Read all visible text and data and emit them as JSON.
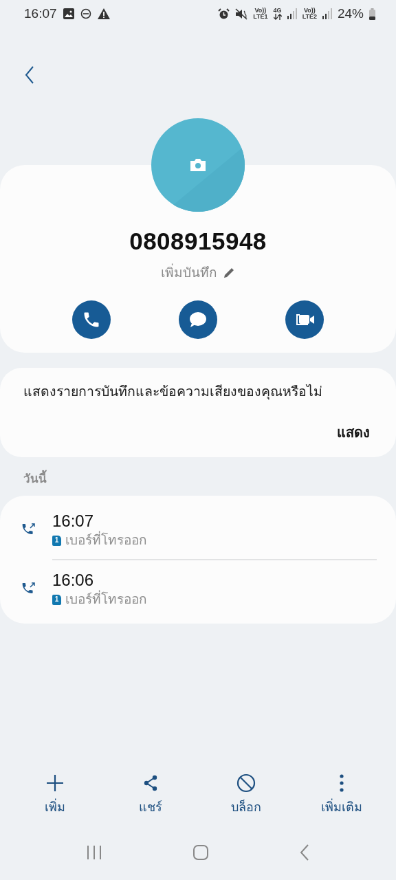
{
  "status_bar": {
    "time": "16:07",
    "sim1_volte": "Vo))",
    "sim1_network": "LTE1",
    "data_type": "4G",
    "sim2_volte": "Vo))",
    "sim2_network": "LTE2",
    "battery": "24%"
  },
  "contact": {
    "number": "0808915948",
    "add_note": "เพิ่มบันทึก"
  },
  "prompt": {
    "message": "แสดงรายการบันทึกและข้อความเสียงของคุณหรือไม่",
    "action": "แสดง"
  },
  "section_header": "วันนี้",
  "calls": [
    {
      "time": "16:07",
      "sim": "1",
      "type": "เบอร์ที่โทรออก"
    },
    {
      "time": "16:06",
      "sim": "1",
      "type": "เบอร์ที่โทรออก"
    }
  ],
  "bottom_actions": [
    {
      "kind": "add",
      "label": "เพิ่ม"
    },
    {
      "kind": "share",
      "label": "แชร์"
    },
    {
      "kind": "block",
      "label": "บล็อก"
    },
    {
      "kind": "more",
      "label": "เพิ่มเติม"
    }
  ]
}
